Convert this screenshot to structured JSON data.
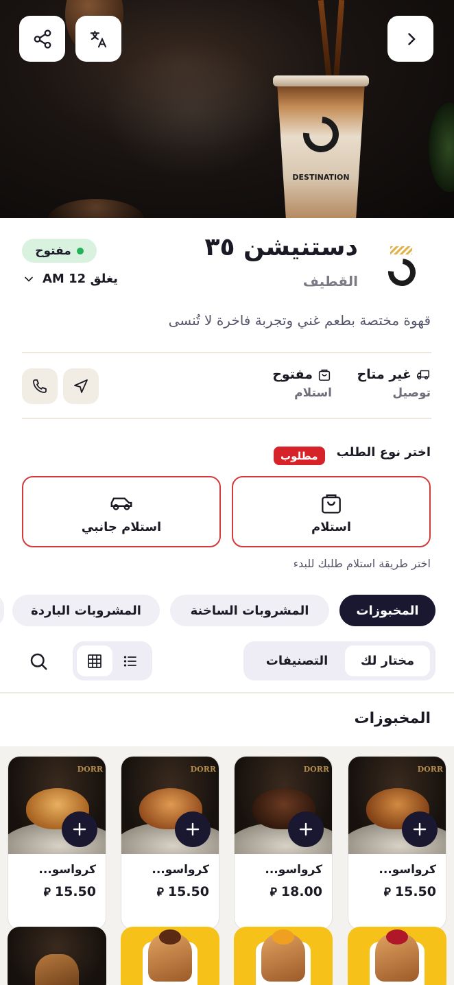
{
  "hero": {
    "cup_brand": "DESTINATION",
    "buttons": {
      "share_icon": "share-icon",
      "translate_icon": "translate-icon",
      "next_icon": "chevron-right-icon"
    }
  },
  "store": {
    "name": "دستنيشن ٣٥",
    "city": "القطيف",
    "status": "مفتوح",
    "closes": "يغلق 12 AM",
    "description": "قهوة مختصة بطعم غني وتجربة فاخرة لا تُنسى"
  },
  "services": {
    "delivery": {
      "status": "غير متاح",
      "label": "توصيل"
    },
    "pickup": {
      "status": "مفتوح",
      "label": "استلام"
    }
  },
  "order_type": {
    "title": "اختر نوع الطلب",
    "required": "مطلوب",
    "options": [
      "استلام",
      "استلام جانبي"
    ],
    "hint": "اختر طريقة استلام طلبك للبدء"
  },
  "categories": [
    "المخبوزات",
    "المشروبات الساخنة",
    "المشروبات الباردة"
  ],
  "segments": [
    "مختار لك",
    "التصنيفات"
  ],
  "section": {
    "title": "المخبوزات"
  },
  "products": [
    {
      "name": "كرواسو...",
      "price": "15.50"
    },
    {
      "name": "كرواسو...",
      "price": "18.00"
    },
    {
      "name": "كرواسو...",
      "price": "15.50"
    },
    {
      "name": "كرواسو...",
      "price": "15.50"
    }
  ],
  "currency_symbol": "⃁",
  "colors": {
    "accent": "#1a1830",
    "required": "#d6232a",
    "open_bg": "#d9f2e0",
    "open_dot": "#21b25a",
    "option_border": "#d33a3a"
  }
}
